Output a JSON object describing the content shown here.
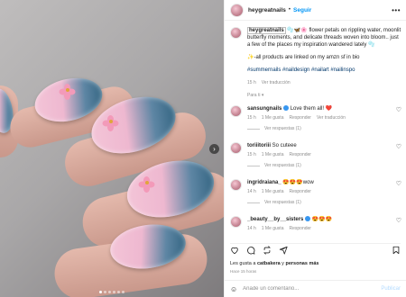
{
  "header": {
    "username": "heygreatnails",
    "separator": "•",
    "follow_label": "Seguir",
    "more_label": "•••"
  },
  "caption": {
    "username": "heygreatnails",
    "text": "🫧🦋🌸 flower petals on rippling water, moonlit butterfly moments, and delicate threads woven into bloom.. just a few of the places my inspiration wandered lately 🫧",
    "line2": "✨-all products are linked on my amzn sf in bio",
    "hashtags": "#summernails #naildesign #nailart #nailinspo",
    "time": "15 h",
    "translation": "Ver traducción"
  },
  "for_you_label": "Para ti",
  "comments": [
    {
      "username": "sansungnails",
      "verified": true,
      "text": "Love them all! ❤️",
      "time": "15 h",
      "likes": "1 Me gusta",
      "reply": "Responder",
      "translation": "Ver traducción",
      "replies": "Ver respuestas (1)"
    },
    {
      "username": "toriiitoriii",
      "verified": false,
      "text": "So cuteee",
      "time": "15 h",
      "likes": "1 Me gusta",
      "reply": "Responder",
      "translation": "",
      "replies": "Ver respuestas (1)"
    },
    {
      "username": "ingridraiana_",
      "verified": false,
      "text": "😍😍😍wow",
      "time": "14 h",
      "likes": "1 Me gusta",
      "reply": "Responder",
      "translation": "",
      "replies": "Ver respuestas (1)"
    },
    {
      "username": "_beauty__by__sisters",
      "verified": true,
      "text": "😍😍😍",
      "time": "14 h",
      "likes": "1 Me gusta",
      "reply": "Responder",
      "translation": "",
      "replies": "Ver respuestas (1)"
    }
  ],
  "likes_text": {
    "prefix": "Les gusta a ",
    "user": "catbakera",
    "middle": " y ",
    "rest": "personas más"
  },
  "post_time": "Hace 15 horas",
  "comment_input": {
    "placeholder": "Añade un comentario...",
    "value": ""
  },
  "publish_label": "Publicar",
  "photo": {
    "slides": 6,
    "active_slide": 0
  },
  "colors": {
    "accent": "#0095f6",
    "link": "#00376b",
    "muted": "#8e8e8e",
    "verified": "#3897f0"
  }
}
